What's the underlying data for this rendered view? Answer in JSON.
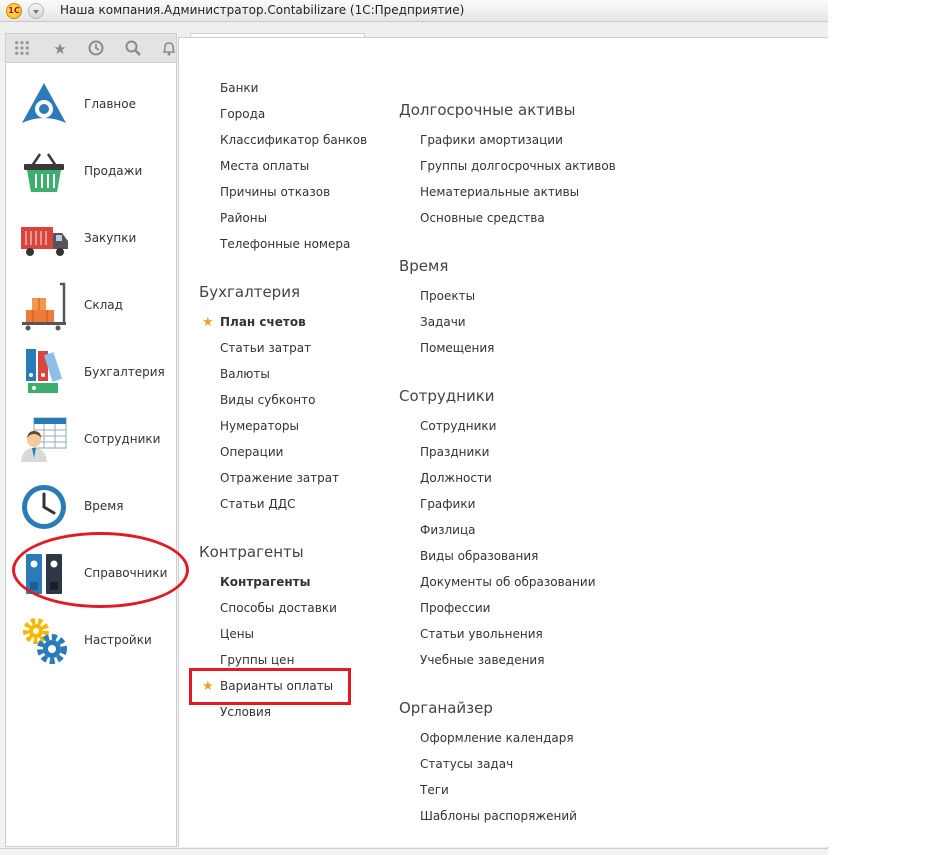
{
  "window": {
    "title": "Наша компания.Администратор.Contabilizare  (1С:Предприятие)",
    "app_icon_label": "1С"
  },
  "toolbar": {
    "icons": [
      "grid-apps-icon",
      "star-icon",
      "history-icon",
      "search-icon",
      "bell-icon"
    ]
  },
  "sidebar": {
    "items": [
      {
        "label": "Главное",
        "icon": "main-icon"
      },
      {
        "label": "Продажи",
        "icon": "basket-icon"
      },
      {
        "label": "Закупки",
        "icon": "truck-icon"
      },
      {
        "label": "Склад",
        "icon": "warehouse-icon"
      },
      {
        "label": "Бухгалтерия",
        "icon": "binders-icon"
      },
      {
        "label": "Сотрудники",
        "icon": "employee-icon"
      },
      {
        "label": "Время",
        "icon": "clock-icon"
      },
      {
        "label": "Справочники",
        "icon": "directory-icon"
      },
      {
        "label": "Настройки",
        "icon": "gears-icon"
      }
    ]
  },
  "content": {
    "col1": {
      "top_links": [
        "Банки",
        "Города",
        "Классификатор банков",
        "Места оплаты",
        "Причины отказов",
        "Районы",
        "Телефонные номера"
      ],
      "groups": [
        {
          "title": "Бухгалтерия",
          "items": [
            {
              "label": "План счетов",
              "bold": true,
              "star": true
            },
            {
              "label": "Статьи затрат"
            },
            {
              "label": "Валюты"
            },
            {
              "label": "Виды субконто"
            },
            {
              "label": "Нумераторы"
            },
            {
              "label": "Операции"
            },
            {
              "label": "Отражение затрат"
            },
            {
              "label": "Статьи ДДС"
            }
          ]
        },
        {
          "title": "Контрагенты",
          "items": [
            {
              "label": "Контрагенты",
              "bold": true
            },
            {
              "label": "Способы доставки"
            },
            {
              "label": "Цены"
            },
            {
              "label": "Группы цен"
            },
            {
              "label": "Варианты оплаты",
              "star": true
            },
            {
              "label": "Условия"
            }
          ]
        }
      ]
    },
    "col2": {
      "groups": [
        {
          "title": "Долгосрочные активы",
          "items": [
            "Графики амортизации",
            "Группы долгосрочных активов",
            "Нематериальные активы",
            "Основные средства"
          ]
        },
        {
          "title": "Время",
          "items": [
            "Проекты",
            "Задачи",
            "Помещения"
          ]
        },
        {
          "title": "Сотрудники",
          "items": [
            "Сотрудники",
            "Праздники",
            "Должности",
            "Графики",
            "Физлица",
            "Виды образования",
            "Документы об образовании",
            "Профессии",
            "Статьи увольнения",
            "Учебные заведения"
          ]
        },
        {
          "title": "Органайзер",
          "items": [
            "Оформление календаря",
            "Статусы задач",
            "Теги",
            "Шаблоны распоряжений"
          ]
        }
      ]
    }
  },
  "colors": {
    "accent_star": "#f0a020",
    "annotation_red": "#e01b24",
    "icon_blue": "#2b7bb9"
  }
}
